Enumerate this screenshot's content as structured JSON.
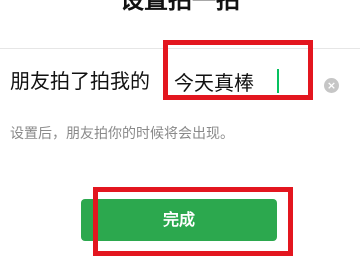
{
  "header": {
    "title": "设置拍一拍"
  },
  "pat_setting": {
    "prefix": "朋友拍了拍我的",
    "value": "今天真棒",
    "clear_icon": "clear-icon"
  },
  "hint": {
    "text": "设置后，朋友拍你的时候将会出现。"
  },
  "actions": {
    "done_label": "完成"
  },
  "colors": {
    "accent": "#07c160",
    "button": "#2ca84e",
    "highlight": "#e3161f",
    "hint": "#8a8a8a"
  }
}
